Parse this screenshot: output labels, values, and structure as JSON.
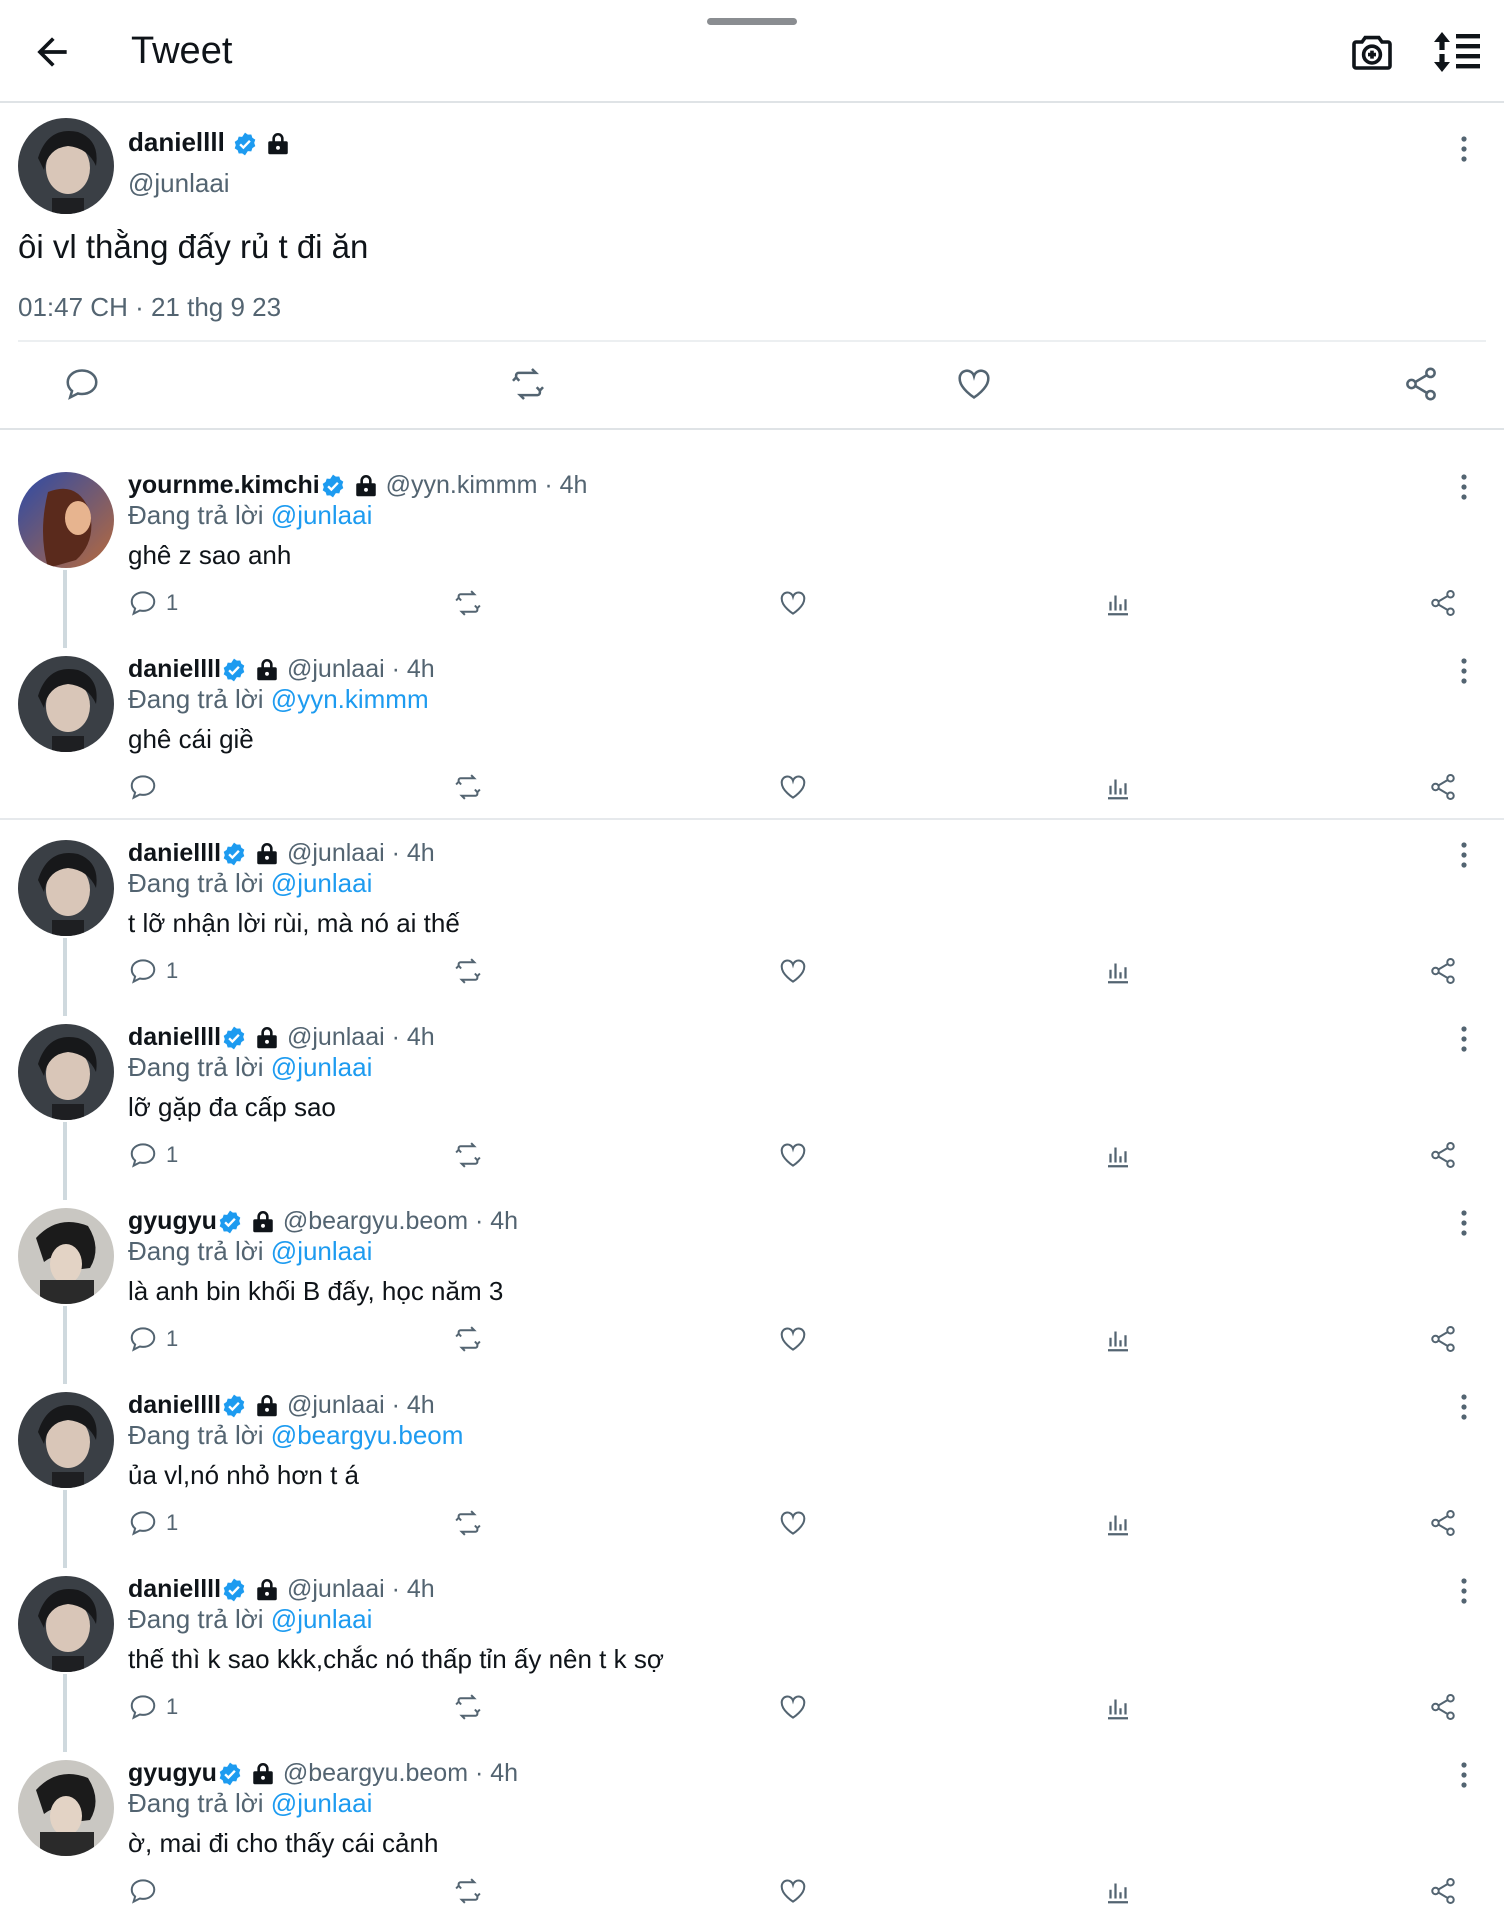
{
  "header": {
    "title": "Tweet",
    "back_icon": "arrow-left-icon",
    "camera_icon": "camera-icon",
    "sort_icon": "sort-icon"
  },
  "main_tweet": {
    "name": "daniellll",
    "handle": "@junlaai",
    "text": "ôi vl thằng đấy rủ t đi ăn",
    "timestamp": "01:47 CH · 21 thg 9 23"
  },
  "replies": [
    {
      "name": "yournme.kimchi",
      "handle": "@yyn.kimmm",
      "time": "· 4h",
      "replying_prefix": "Đang trả lời",
      "replying_to": "@junlaai",
      "text": "ghê z sao anh",
      "reply_count": "1",
      "avatar": "girl"
    },
    {
      "name": "daniellll",
      "handle": "@junlaai",
      "time": "· 4h",
      "replying_prefix": "Đang trả lời",
      "replying_to": "@yyn.kimmm",
      "text": "ghê cái giề",
      "reply_count": "",
      "avatar": "daniel"
    },
    {
      "name": "daniellll",
      "handle": "@junlaai",
      "time": "· 4h",
      "replying_prefix": "Đang trả lời",
      "replying_to": "@junlaai",
      "text": "t lỡ nhận lời rùi, mà nó ai thế",
      "reply_count": "1",
      "avatar": "daniel"
    },
    {
      "name": "daniellll",
      "handle": "@junlaai",
      "time": "· 4h",
      "replying_prefix": "Đang trả lời",
      "replying_to": "@junlaai",
      "text": "lỡ gặp đa cấp sao",
      "reply_count": "1",
      "avatar": "daniel"
    },
    {
      "name": "gyugyu",
      "handle": "@beargyu.beom",
      "time": "· 4h",
      "replying_prefix": "Đang trả lời",
      "replying_to": "@junlaai",
      "text": "là anh bin khối B đấy, học năm 3",
      "reply_count": "1",
      "avatar": "gyu"
    },
    {
      "name": "daniellll",
      "handle": "@junlaai",
      "time": "· 4h",
      "replying_prefix": "Đang trả lời",
      "replying_to": "@beargyu.beom",
      "text": "ủa vl,nó nhỏ hơn t á",
      "reply_count": "1",
      "avatar": "daniel"
    },
    {
      "name": "daniellll",
      "handle": "@junlaai",
      "time": "· 4h",
      "replying_prefix": "Đang trả lời",
      "replying_to": "@junlaai",
      "text": "thế thì k sao kkk,chắc nó thấp tỉn ấy nên t k sợ",
      "reply_count": "1",
      "avatar": "daniel"
    },
    {
      "name": "gyugyu",
      "handle": "@beargyu.beom",
      "time": "· 4h",
      "replying_prefix": "Đang trả lời",
      "replying_to": "@junlaai",
      "text": "ờ, mai đi cho thấy cái cảnh",
      "reply_count": "",
      "avatar": "gyu"
    }
  ],
  "colors": {
    "link": "#1d9bf0",
    "verified": "#1d9bf0",
    "muted": "#536471",
    "divider": "#dfe3e6"
  }
}
